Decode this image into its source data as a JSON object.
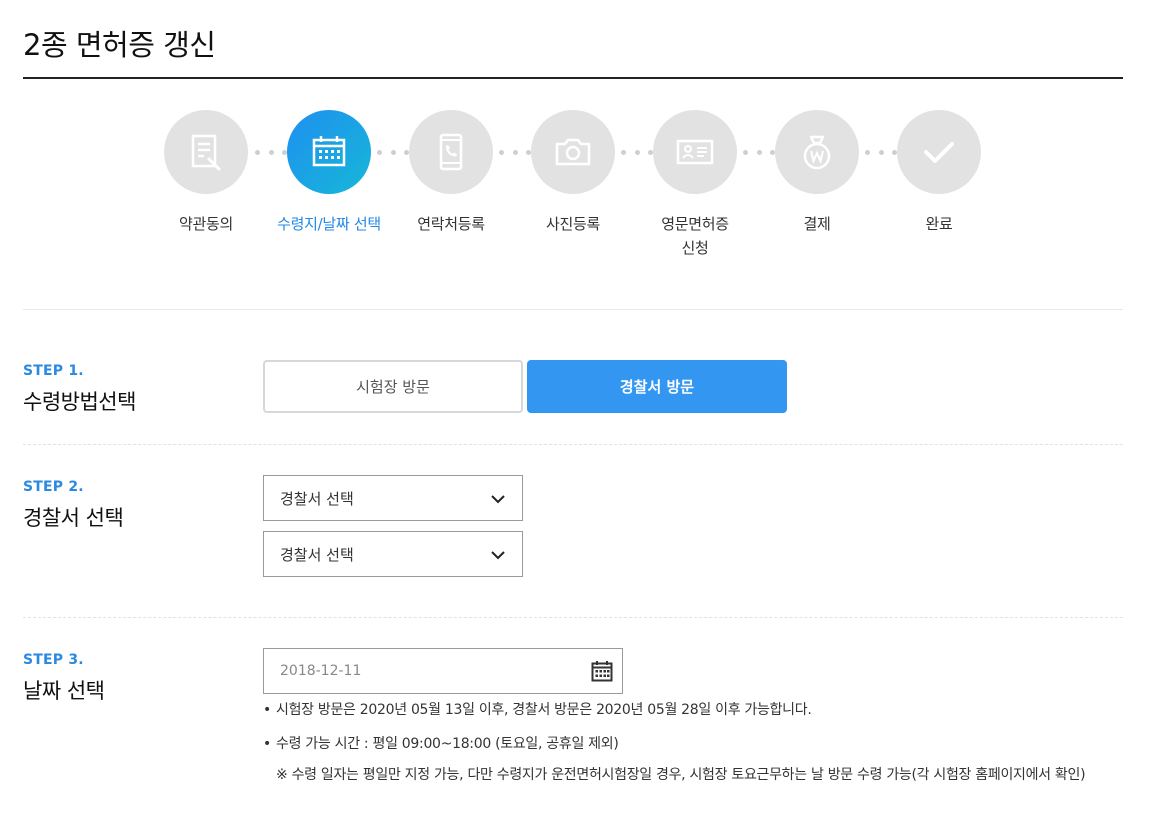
{
  "page": {
    "title": "2종 면허증 갱신"
  },
  "progress": {
    "active_index": 1,
    "steps": [
      {
        "label": "약관동의",
        "icon": "document-pen-icon"
      },
      {
        "label": "수령지/날짜 선택",
        "icon": "calendar-icon"
      },
      {
        "label": "연락처등록",
        "icon": "phone-icon"
      },
      {
        "label": "사진등록",
        "icon": "camera-icon"
      },
      {
        "label": "영문면허증\n신청",
        "icon": "id-card-icon"
      },
      {
        "label": "결제",
        "icon": "money-bag-icon"
      },
      {
        "label": "완료",
        "icon": "check-icon"
      }
    ]
  },
  "step1": {
    "number": "STEP 1.",
    "title": "수령방법선택",
    "options": [
      {
        "label": "시험장 방문",
        "selected": false
      },
      {
        "label": "경찰서 방문",
        "selected": true
      }
    ]
  },
  "step2": {
    "number": "STEP 2.",
    "title": "경찰서 선택",
    "selects": [
      {
        "value": "경찰서 선택"
      },
      {
        "value": "경찰서 선택"
      }
    ]
  },
  "step3": {
    "number": "STEP 3.",
    "title": "날짜 선택",
    "date_value": "2018-12-11",
    "notes": [
      "시험장 방문은 2020년 05월 13일 이후, 경찰서 방문은 2020년 05월 28일 이후 가능합니다.",
      "수령 가능 시간 : 평일 09:00~18:00 (토요일, 공휴일 제외)"
    ],
    "sub_note": "※ 수령 일자는 평일만 지정 가능, 다만 수령지가 운전면허시험장일 경우, 시험장 토요근무하는 날 방문 수령 가능(각 시험장 홈페이지에서 확인)"
  },
  "colors": {
    "accent": "#3397f2",
    "active_step_label": "#2388e8",
    "inactive_circle": "#e2e2e2"
  }
}
